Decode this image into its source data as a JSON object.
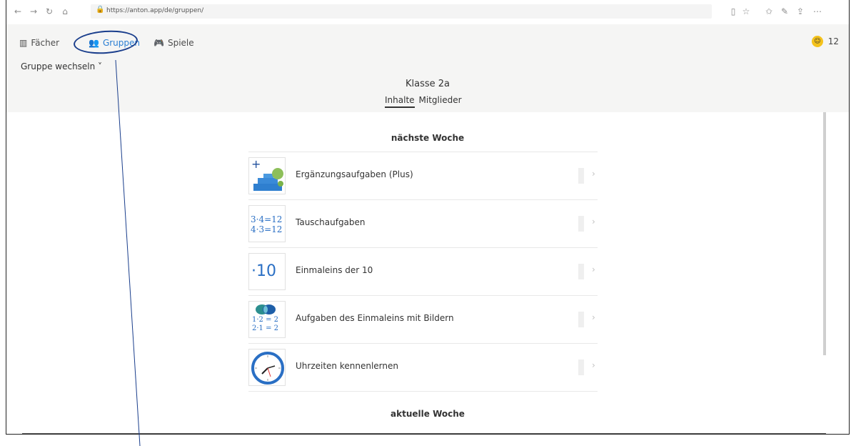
{
  "browser": {
    "url": "https://anton.app/de/gruppen/",
    "back_icon": "←",
    "forward_icon": "→",
    "reload_icon": "↻",
    "home_icon": "⌂",
    "lock_icon": "🔒",
    "reader_icon": "▯",
    "favorite_icon": "☆",
    "favorites_icon": "✩",
    "pen_icon": "✎",
    "share_icon": "⇪",
    "more_icon": "⋯"
  },
  "app_nav": {
    "tabs": [
      {
        "label": "Fächer",
        "icon": "▥"
      },
      {
        "label": "Gruppen",
        "icon": "👥"
      },
      {
        "label": "Spiele",
        "icon": "🎮"
      }
    ],
    "coin_icon": "☺",
    "coin_count": "12"
  },
  "group": {
    "switch_label": "Gruppe wechseln ˅",
    "title": "Klasse 2a",
    "tabs": [
      "Inhalte",
      "Mitglieder"
    ]
  },
  "sections": {
    "next_week": "nächste Woche",
    "current_week": "aktuelle Woche"
  },
  "topics": [
    {
      "label": "Ergänzungsaufgaben (Plus)"
    },
    {
      "label": "Tauschaufgaben",
      "thumb_line1": "3·4=12",
      "thumb_line2": "4·3=12"
    },
    {
      "label": "Einmaleins der 10",
      "thumb_text": "·10"
    },
    {
      "label": "Aufgaben des Einmaleins mit Bildern",
      "thumb_line1": "1·2 = 2",
      "thumb_line2": "2·1 = 2"
    },
    {
      "label": "Uhrzeiten kennenlernen"
    }
  ],
  "chevron": "›",
  "colors": {
    "accent": "#2b7fd4",
    "thumb_blue": "#2a6fc4",
    "annotation": "#1a3e8c"
  }
}
